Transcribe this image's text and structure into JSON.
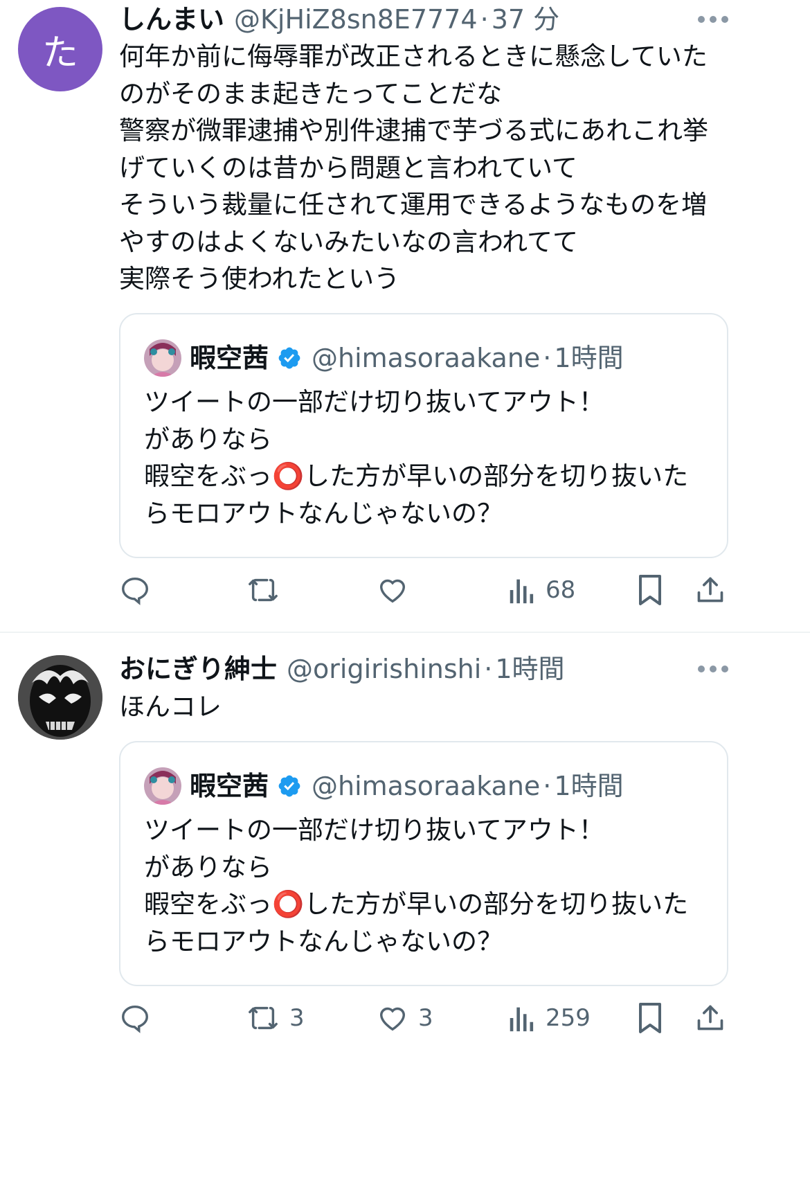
{
  "posts": [
    {
      "author": "しんまい",
      "handle": "@KjHiZ8sn8E7774",
      "dot": "·",
      "time": "37 分",
      "avatar_letter": "た",
      "avatar_color": "#7e57c2",
      "text": "何年か前に侮辱罪が改正されるときに懸念していたのがそのまま起きたってことだな\n警察が微罪逮捕や別件逮捕で芋づる式にあれこれ挙げていくのは昔から問題と言われていて\nそういう裁量に任されて運用できるようなものを増やすのはよくないみたいなの言われてて\n実際そう使われたという",
      "quote": {
        "author": "暇空茜",
        "handle": "@himasoraakane",
        "dot": "·",
        "time": "1時間",
        "text": "ツイートの一部だけ切り抜いてアウト！\nがありなら\n暇空をぶっ⭕️した方が早いの部分を切り抜いたらモロアウトなんじゃないの？"
      },
      "metrics": {
        "replies": "",
        "reposts": "",
        "likes": "",
        "views": "68"
      }
    },
    {
      "author": "おにぎり紳士",
      "handle": "@origirishinshi",
      "dot": "·",
      "time": "1時間",
      "text": "ほんコレ",
      "quote": {
        "author": "暇空茜",
        "handle": "@himasoraakane",
        "dot": "·",
        "time": "1時間",
        "text": "ツイートの一部だけ切り抜いてアウト！\nがありなら\n暇空をぶっ⭕️した方が早いの部分を切り抜いたらモロアウトなんじゃないの？"
      },
      "metrics": {
        "replies": "",
        "reposts": "3",
        "likes": "3",
        "views": "259"
      }
    }
  ],
  "icons": {
    "reply": "reply-icon",
    "repost": "repost-icon",
    "like": "heart-icon",
    "views": "views-icon",
    "bookmark": "bookmark-icon",
    "share": "share-icon",
    "more": "more-icon",
    "verified": "verified-badge-icon"
  },
  "colors": {
    "text": "#0f1419",
    "secondary": "#536471",
    "verified": "#1d9bf0",
    "border": "#e1e8ed"
  }
}
